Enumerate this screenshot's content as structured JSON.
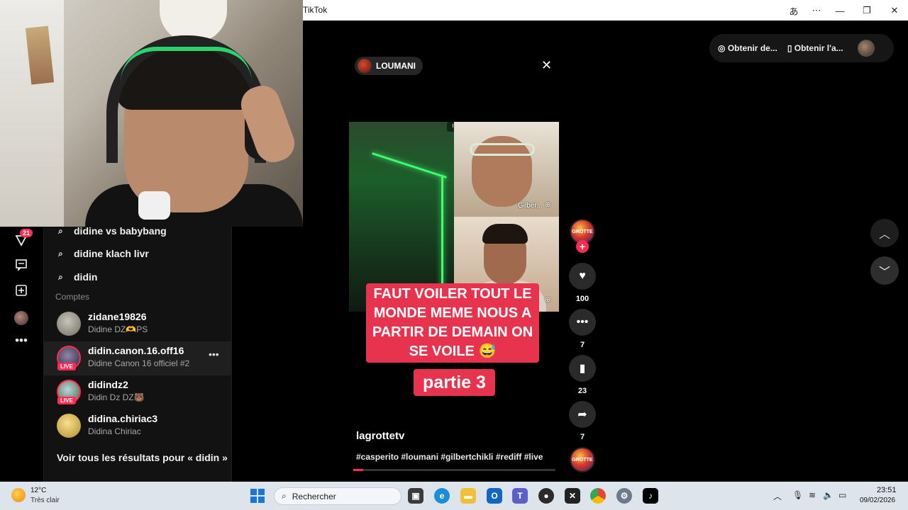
{
  "window": {
    "title": "TikTok",
    "translate_icon": "translate-icon",
    "more_icon": "more-icon",
    "controls": [
      "minimize-icon",
      "restore-icon",
      "close-icon"
    ]
  },
  "rail": {
    "inbox_badge": "21",
    "icons": [
      "inbox-icon",
      "messages-icon",
      "upload-icon",
      "profile-icon",
      "more-icon"
    ]
  },
  "search_suggestions": [
    {
      "text": "didine vs babybang"
    },
    {
      "text": "didine klach livr"
    },
    {
      "text": "didin"
    }
  ],
  "accounts_heading": "Comptes",
  "accounts": [
    {
      "name": "zidane19826",
      "sub": "Didine DZ🫶PS",
      "live": false,
      "avatar_color": "#9a9a8c"
    },
    {
      "name": "didin.canon.16.off16",
      "sub": "Didine Canon 16 officiel #2",
      "live": true,
      "live_label": "LIVE",
      "avatar_color": "#5b5475"
    },
    {
      "name": "didindz2",
      "sub": "Didin Dz DZ🐻",
      "live": true,
      "live_label": "LIVE",
      "avatar_color": "#7aa0b5"
    },
    {
      "name": "didina.chiriac3",
      "sub": "Didina Chiriac",
      "live": false,
      "avatar_color": "#e3c35c"
    }
  ],
  "see_all": "Voir tous les résultats pour « didin »",
  "top_pills": {
    "get_coins": "Obtenir de...",
    "get_app": "Obtenir l'a..."
  },
  "video": {
    "creator": "LOUMANI",
    "tile_b_tag": "Gilber...",
    "caption_main": "FAUT VOILER TOUT LE MONDE MEME NOUS A PARTIR DE DEMAIN ON SE VOILE 😅",
    "caption_part": "partie 3",
    "username": "lagrottetv",
    "hashtags": "#casperito #loumani #gilbertchikli #rediff #live",
    "progress": 0.05,
    "author_avatar_text": "GROTTE"
  },
  "actions": {
    "likes": "100",
    "comments": "7",
    "saves": "23",
    "shares": "7"
  },
  "taskbar": {
    "temperature": "12°C",
    "condition": "Très clair",
    "search_placeholder": "Rechercher",
    "time": "23:51",
    "date": "09/02/2026",
    "apps": [
      {
        "name": "task-view-icon",
        "color": "#3b3b3b"
      },
      {
        "name": "edge-icon",
        "color": "#1b8fd6"
      },
      {
        "name": "file-explorer-icon",
        "color": "#f2c037"
      },
      {
        "name": "outlook-icon",
        "color": "#1466c2"
      },
      {
        "name": "teams-icon",
        "color": "#5b5fc7"
      },
      {
        "name": "obs-icon",
        "color": "#2b2b2b"
      },
      {
        "name": "capcut-icon",
        "color": "#222222"
      },
      {
        "name": "chrome-icon",
        "color": "#34a853"
      },
      {
        "name": "settings-icon",
        "color": "#6c7a89"
      },
      {
        "name": "tiktok-icon",
        "color": "#000000"
      }
    ]
  },
  "colors": {
    "accent": "#fe2c55",
    "caption_bg": "#e8334f",
    "neon": "#3eff6e"
  }
}
